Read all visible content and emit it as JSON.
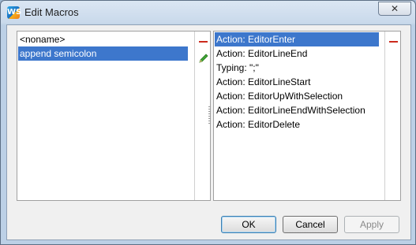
{
  "window": {
    "title": "Edit Macros",
    "app_icon_text": "WS",
    "close_label": "✕"
  },
  "macros": {
    "items": [
      {
        "label": "<noname>",
        "selected": false
      },
      {
        "label": "append semicolon",
        "selected": true
      }
    ]
  },
  "actions": {
    "items": [
      {
        "label": "Action: EditorEnter",
        "selected": true
      },
      {
        "label": "Action: EditorLineEnd",
        "selected": false
      },
      {
        "label": "Typing: \";\"",
        "selected": false
      },
      {
        "label": "Action: EditorLineStart",
        "selected": false
      },
      {
        "label": "Action: EditorUpWithSelection",
        "selected": false
      },
      {
        "label": "Action: EditorLineEndWithSelection",
        "selected": false
      },
      {
        "label": "Action: EditorDelete",
        "selected": false
      }
    ]
  },
  "buttons": {
    "ok": "OK",
    "cancel": "Cancel",
    "apply": "Apply"
  },
  "colors": {
    "selection": "#3d77cc",
    "remove_icon": "#cc2a1d",
    "edit_icon": "#3fa535"
  }
}
